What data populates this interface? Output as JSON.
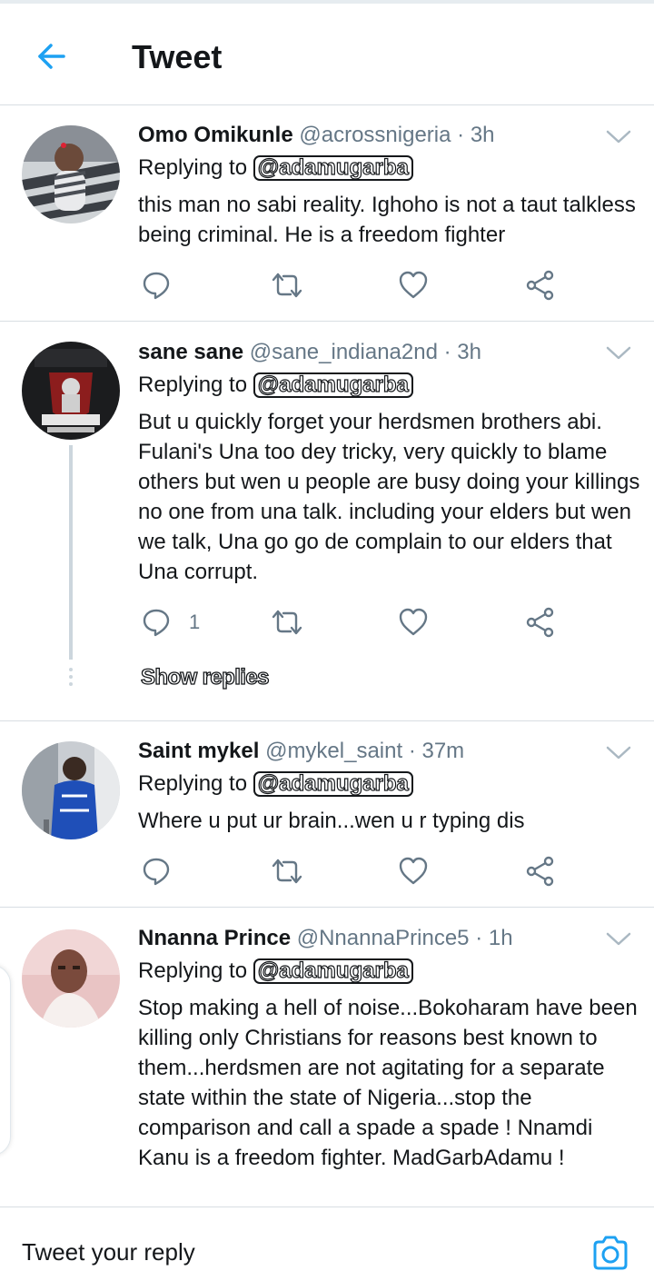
{
  "header": {
    "title": "Tweet",
    "back_icon": "arrow-left-icon",
    "accent_color": "#1da1f2"
  },
  "tweets": [
    {
      "name": "Omo Omikunle",
      "handle": "@acrossnigeria",
      "time": "· 3h",
      "replying_prefix": "Replying to",
      "replying_to": "@adamugarba",
      "text": "this man no sabi reality. Ighoho is not a taut talkless being criminal. He is a freedom fighter",
      "reply_count": ""
    },
    {
      "name": "sane sane",
      "handle": "@sane_indiana2nd",
      "time": "· 3h",
      "replying_prefix": "Replying to",
      "replying_to": "@adamugarba",
      "text": "But u quickly forget your herdsmen brothers abi. Fulani's Una too dey tricky, very quickly to blame others but wen u people are busy doing your killings no one from una talk. including your elders but wen we talk, Una go go de complain to our elders that Una corrupt.",
      "reply_count": "1",
      "show_replies": "Show replies"
    },
    {
      "name": "Saint mykel",
      "handle": "@mykel_saint",
      "time": "· 37m",
      "replying_prefix": "Replying to",
      "replying_to": "@adamugarba",
      "text": "Where u put ur brain...wen u r typing dis",
      "reply_count": ""
    },
    {
      "name": "Nnanna Prince",
      "handle": "@NnannaPrince5",
      "time": "· 1h",
      "replying_prefix": "Replying to",
      "replying_to": "@adamugarba",
      "text": "Stop making a hell of noise...Bokoharam have been killing only Christians for reasons best known to them...herdsmen are not agitating for a separate state within the state of Nigeria...stop the comparison and call a spade a spade ! Nnamdi Kanu is a freedom fighter. MadGarbAdamu !",
      "reply_count": ""
    }
  ],
  "composer": {
    "placeholder": "Tweet your reply",
    "camera_icon": "camera-icon"
  }
}
